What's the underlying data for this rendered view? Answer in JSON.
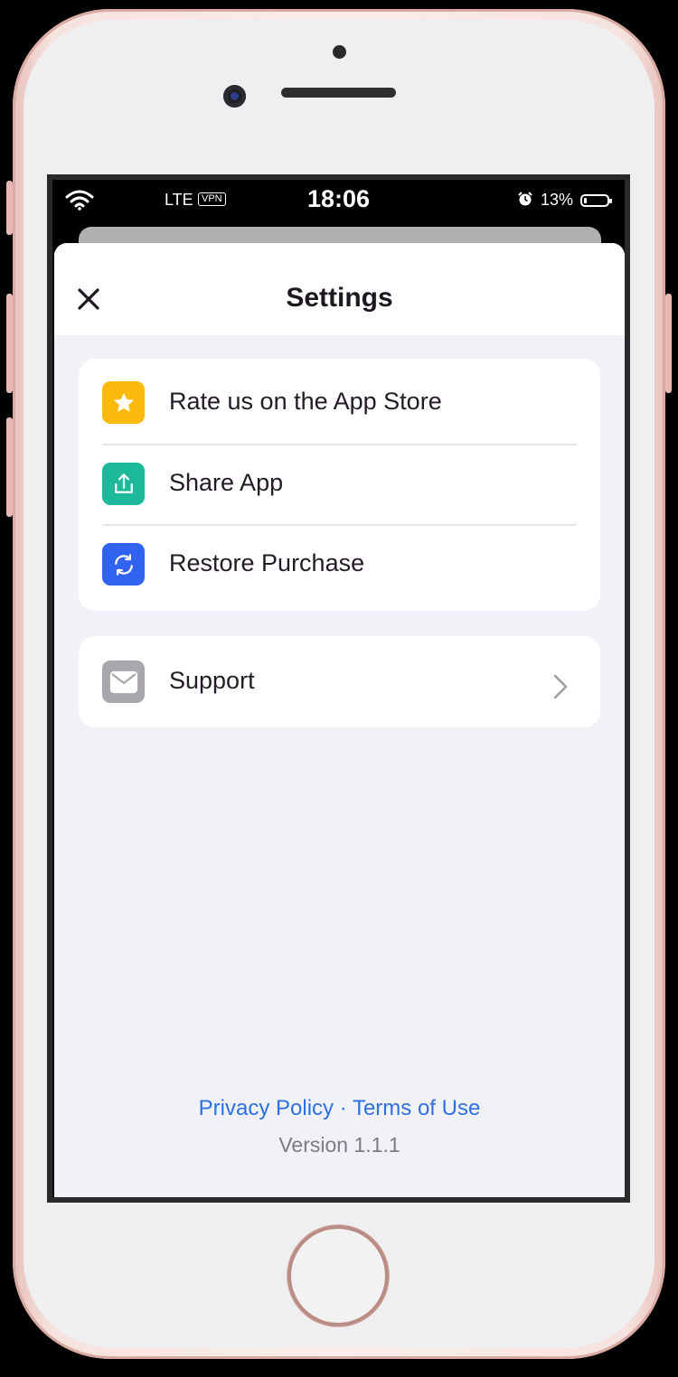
{
  "status_bar": {
    "network": "LTE",
    "vpn": "VPN",
    "time": "18:06",
    "battery_percent": "13%",
    "battery_level": 0.13
  },
  "header": {
    "title": "Settings"
  },
  "menu_group_1": {
    "items": [
      {
        "label": "Rate us on the App Store",
        "icon": "star-icon",
        "color": "#FDBA0C"
      },
      {
        "label": "Share App",
        "icon": "share-icon",
        "color": "#1DB99A"
      },
      {
        "label": "Restore Purchase",
        "icon": "restore-icon",
        "color": "#2F63F0"
      }
    ]
  },
  "menu_group_2": {
    "items": [
      {
        "label": "Support",
        "icon": "mail-icon",
        "color": "#A9A6AC"
      }
    ]
  },
  "footer": {
    "privacy_policy": "Privacy Policy",
    "separator": "·",
    "terms_of_use": "Terms of Use",
    "version": "Version 1.1.1"
  }
}
